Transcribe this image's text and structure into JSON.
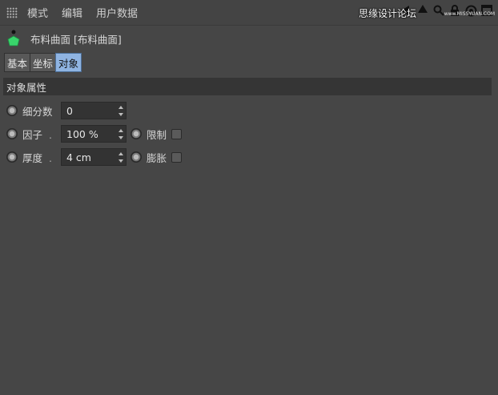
{
  "menubar": {
    "items": [
      "模式",
      "编辑",
      "用户数据"
    ]
  },
  "watermark": {
    "text": "思缘设计论坛",
    "url": "www.MISSYUAN.COM"
  },
  "object": {
    "title": "布料曲面 [布料曲面]"
  },
  "tabs": [
    {
      "label": "基本",
      "active": false
    },
    {
      "label": "坐标",
      "active": false
    },
    {
      "label": "对象",
      "active": true
    }
  ],
  "section": {
    "title": "对象属性"
  },
  "properties": {
    "subdivisions": {
      "label": "细分数",
      "value": "0"
    },
    "factor": {
      "label": "因子",
      "dot": ".",
      "value": "100 %"
    },
    "limit": {
      "label": "限制",
      "checked": false
    },
    "thickness": {
      "label": "厚度",
      "dot": ".",
      "value": "4 cm"
    },
    "expand": {
      "label": "膨胀",
      "checked": false
    }
  },
  "colors": {
    "panel_bg": "#464646",
    "active_tab": "#8fb4e2",
    "section_bg": "#353535",
    "object_icon": "#39d46b"
  }
}
